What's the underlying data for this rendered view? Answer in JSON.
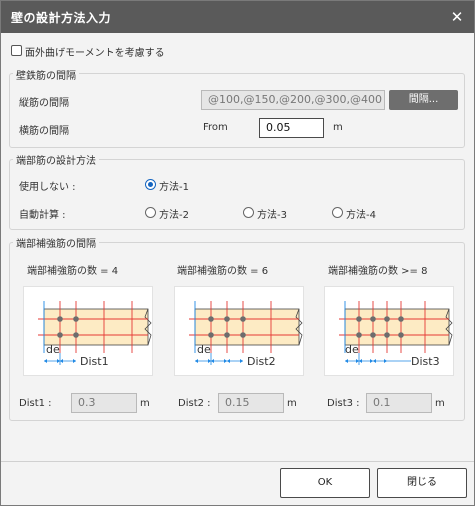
{
  "dialog": {
    "title": "壁の設計方法入力",
    "close_glyph": "✕"
  },
  "out_of_plane": {
    "label": "面外曲げモーメントを考慮する",
    "checked": false
  },
  "rebar_spacing": {
    "group_label": "壁鉄筋の間隔",
    "vertical_label": "縦筋の間隔",
    "vertical_value": "@100,@150,@200,@300,@400",
    "spacing_button": "間隔...",
    "horizontal_label": "横筋の間隔",
    "from_label": "From",
    "horizontal_value": "0.05",
    "horizontal_unit": "m"
  },
  "end_design": {
    "group_label": "端部筋の設計方法",
    "unused_label": "使用しない :",
    "auto_label": "自動計算 :",
    "methods": [
      "方法-1",
      "方法-2",
      "方法-3",
      "方法-4"
    ],
    "selected": "方法-1"
  },
  "end_spacing": {
    "group_label": "端部補強筋の間隔",
    "cases": [
      {
        "title": "端部補強筋の数 = 4",
        "dist_label": "Dist1",
        "field_label": "Dist1 :",
        "value": "0.3",
        "unit": "m"
      },
      {
        "title": "端部補強筋の数 = 6",
        "dist_label": "Dist2",
        "field_label": "Dist2 :",
        "value": "0.15",
        "unit": "m"
      },
      {
        "title": "端部補強筋の数 >= 8",
        "dist_label": "Dist3",
        "field_label": "Dist3 :",
        "value": "0.1",
        "unit": "m"
      }
    ],
    "de_label": "de"
  },
  "footer": {
    "ok": "OK",
    "close": "閉じる"
  },
  "colors": {
    "titlebar": "#5a5a5a",
    "accent": "#1565c0",
    "wall_fill": "#fdebc4",
    "rebar_line": "#e53935",
    "dim_line": "#1e88e5"
  }
}
